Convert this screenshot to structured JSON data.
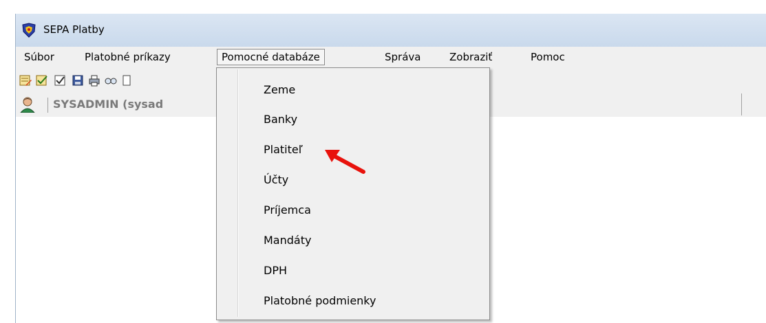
{
  "window": {
    "title": "SEPA Platby",
    "icon": "app-shield-icon"
  },
  "menubar": {
    "items": [
      {
        "label": "Súbor"
      },
      {
        "label": "Platobné príkazy"
      },
      {
        "label": "Pomocné databáze",
        "active": true
      },
      {
        "label": "Správa"
      },
      {
        "label": "Zobraziť"
      },
      {
        "label": "Pomoc"
      }
    ]
  },
  "toolbar": {
    "icons": [
      "list-edit-icon",
      "list-check-icon",
      "checklist-icon",
      "save-icon",
      "print-icon",
      "search-icon",
      "copy-icon"
    ]
  },
  "userbar": {
    "user": "SYSADMIN (sysad",
    "icon": "user-icon"
  },
  "dropdown": {
    "items": [
      {
        "label": "Zeme"
      },
      {
        "label": "Banky"
      },
      {
        "label": "Platiteľ"
      },
      {
        "label": "Účty"
      },
      {
        "label": "Príjemca"
      },
      {
        "label": "Mandáty"
      },
      {
        "label": "DPH"
      },
      {
        "label": "Platobné podmienky"
      }
    ]
  },
  "colors": {
    "annotation_arrow": "#e8120c",
    "titlebar": "#c9d9ec"
  }
}
